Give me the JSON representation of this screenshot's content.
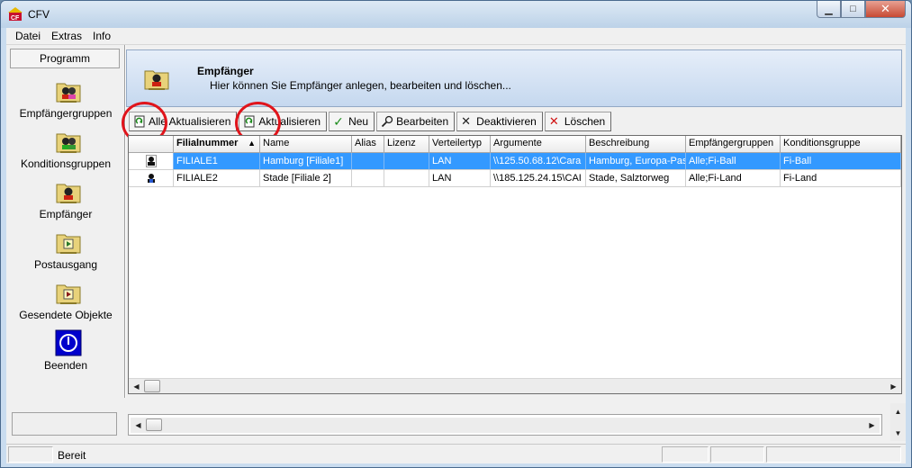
{
  "window": {
    "title": "CFV"
  },
  "menu": {
    "items": [
      "Datei",
      "Extras",
      "Info"
    ]
  },
  "sidebar": {
    "header": "Programm",
    "items": [
      {
        "label": "Empfängergruppen",
        "icon": "users-folder-icon"
      },
      {
        "label": "Konditionsgruppen",
        "icon": "users-folder-icon"
      },
      {
        "label": "Empfänger",
        "icon": "user-folder-icon"
      },
      {
        "label": "Postausgang",
        "icon": "outbox-folder-icon"
      },
      {
        "label": "Gesendete Objekte",
        "icon": "sent-folder-icon"
      },
      {
        "label": "Beenden",
        "icon": "power-icon"
      }
    ]
  },
  "header": {
    "title": "Empfänger",
    "subtitle": "Hier können Sie Empfänger anlegen, bearbeiten und löschen..."
  },
  "toolbar": {
    "alle_aktualisieren": "Alle Aktualisieren",
    "aktualisieren": "Aktualisieren",
    "neu": "Neu",
    "bearbeiten": "Bearbeiten",
    "deaktivieren": "Deaktivieren",
    "loeschen": "Löschen"
  },
  "table": {
    "columns": [
      "",
      "Filialnummer",
      "Name",
      "Alias",
      "Lizenz",
      "Verteilertyp",
      "Argumente",
      "Beschreibung",
      "Empfängergruppen",
      "Konditionsgruppe"
    ],
    "sorted_column": "Filialnummer",
    "rows": [
      [
        "",
        "FILIALE1",
        "Hamburg [Filiale1]",
        "",
        "",
        "LAN",
        "\\\\125.50.68.12\\Cara",
        "Hamburg, Europa-Pas:",
        "Alle;Fi-Ball",
        "Fi-Ball"
      ],
      [
        "",
        "FILIALE2",
        "Stade [Filiale 2]",
        "",
        "",
        "LAN",
        "\\\\185.125.24.15\\CAI",
        "Stade, Salztorweg",
        "Alle;Fi-Land",
        "Fi-Land"
      ]
    ],
    "selected_row": 0
  },
  "status": {
    "text": "Bereit"
  },
  "colors": {
    "selection": "#3399ff",
    "highlight_ring": "#e0141b"
  }
}
